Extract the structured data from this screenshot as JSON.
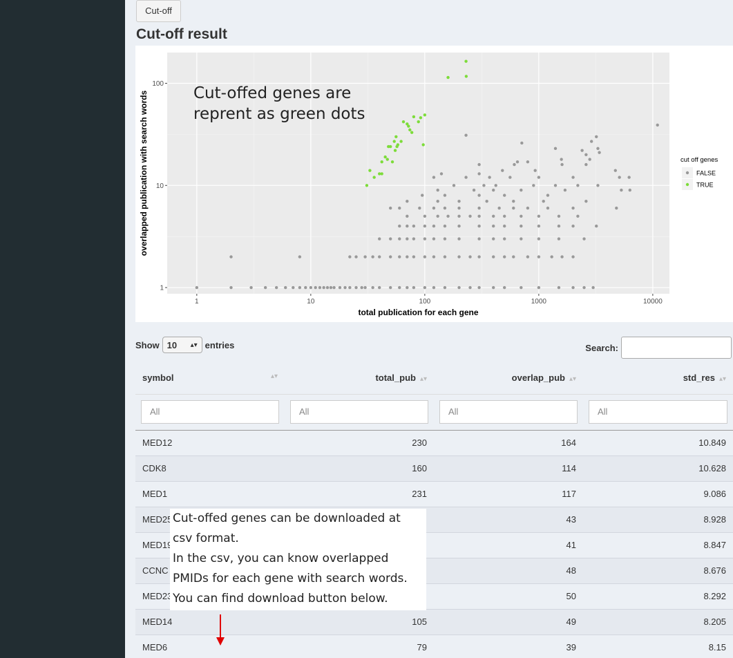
{
  "cutoff_button": "Cut-off",
  "section_title": "Cut-off result",
  "plot_note": [
    "Cut-offed genes are",
    "reprent as green dots"
  ],
  "chart_data": {
    "type": "scatter",
    "title": "",
    "xlabel": "total publication for each gene",
    "ylabel": "overlapped publication with search words",
    "x_scale": "log10",
    "y_scale": "log10",
    "xlim": [
      0.55,
      14000
    ],
    "ylim": [
      0.87,
      200
    ],
    "x_ticks": [
      1,
      10,
      100,
      1000,
      10000
    ],
    "x_tick_labels": [
      "1",
      "10",
      "100",
      "1000",
      "10000"
    ],
    "y_ticks": [
      1,
      10,
      100
    ],
    "y_tick_labels": [
      "1",
      "10",
      "100"
    ],
    "grid": true,
    "legend_title": "cut off genes",
    "legend_position": "right",
    "series": [
      {
        "name": "FALSE",
        "color": "#999999",
        "points": [
          [
            1,
            1
          ],
          [
            2,
            1
          ],
          [
            2,
            2
          ],
          [
            3,
            1
          ],
          [
            4,
            1
          ],
          [
            5,
            1
          ],
          [
            6,
            1
          ],
          [
            7,
            1
          ],
          [
            8,
            1
          ],
          [
            8,
            2
          ],
          [
            9,
            1
          ],
          [
            10,
            1
          ],
          [
            11,
            1
          ],
          [
            12,
            1
          ],
          [
            13,
            1
          ],
          [
            14,
            1
          ],
          [
            15,
            1
          ],
          [
            16,
            1
          ],
          [
            18,
            1
          ],
          [
            20,
            1
          ],
          [
            22,
            1
          ],
          [
            25,
            1
          ],
          [
            28,
            1
          ],
          [
            30,
            1
          ],
          [
            35,
            1
          ],
          [
            40,
            1
          ],
          [
            50,
            1
          ],
          [
            60,
            1
          ],
          [
            70,
            1
          ],
          [
            80,
            1
          ],
          [
            100,
            1
          ],
          [
            120,
            1
          ],
          [
            150,
            1
          ],
          [
            200,
            1
          ],
          [
            250,
            1
          ],
          [
            300,
            1
          ],
          [
            400,
            1
          ],
          [
            500,
            1
          ],
          [
            700,
            1
          ],
          [
            1000,
            1
          ],
          [
            1500,
            1
          ],
          [
            2000,
            1
          ],
          [
            2500,
            1
          ],
          [
            3000,
            1
          ],
          [
            22,
            2
          ],
          [
            25,
            2
          ],
          [
            30,
            2
          ],
          [
            35,
            2
          ],
          [
            40,
            2
          ],
          [
            50,
            2
          ],
          [
            60,
            2
          ],
          [
            70,
            2
          ],
          [
            80,
            2
          ],
          [
            100,
            2
          ],
          [
            120,
            2
          ],
          [
            150,
            2
          ],
          [
            200,
            2
          ],
          [
            250,
            2
          ],
          [
            300,
            2
          ],
          [
            400,
            2
          ],
          [
            500,
            2
          ],
          [
            600,
            2
          ],
          [
            800,
            2
          ],
          [
            1000,
            2
          ],
          [
            1300,
            2
          ],
          [
            1600,
            2
          ],
          [
            2000,
            2
          ],
          [
            40,
            3
          ],
          [
            50,
            3
          ],
          [
            60,
            3
          ],
          [
            70,
            3
          ],
          [
            80,
            3
          ],
          [
            100,
            3
          ],
          [
            120,
            3
          ],
          [
            150,
            3
          ],
          [
            200,
            3
          ],
          [
            300,
            3
          ],
          [
            400,
            3
          ],
          [
            500,
            3
          ],
          [
            700,
            3
          ],
          [
            1000,
            3
          ],
          [
            1500,
            3
          ],
          [
            2500,
            3
          ],
          [
            60,
            4
          ],
          [
            70,
            4
          ],
          [
            80,
            4
          ],
          [
            100,
            4
          ],
          [
            120,
            4
          ],
          [
            150,
            4
          ],
          [
            200,
            4
          ],
          [
            300,
            4
          ],
          [
            400,
            4
          ],
          [
            500,
            4
          ],
          [
            700,
            4
          ],
          [
            1000,
            4
          ],
          [
            1500,
            4
          ],
          [
            2000,
            4
          ],
          [
            3200,
            4
          ],
          [
            70,
            5
          ],
          [
            100,
            5
          ],
          [
            130,
            5
          ],
          [
            160,
            5
          ],
          [
            200,
            5
          ],
          [
            250,
            5
          ],
          [
            300,
            5
          ],
          [
            400,
            5
          ],
          [
            500,
            5
          ],
          [
            700,
            5
          ],
          [
            1000,
            5
          ],
          [
            1500,
            5
          ],
          [
            2200,
            5
          ],
          [
            50,
            6
          ],
          [
            60,
            6
          ],
          [
            90,
            6
          ],
          [
            120,
            6
          ],
          [
            150,
            6
          ],
          [
            200,
            6
          ],
          [
            300,
            6
          ],
          [
            450,
            6
          ],
          [
            600,
            6
          ],
          [
            800,
            6
          ],
          [
            1200,
            6
          ],
          [
            2000,
            6
          ],
          [
            4800,
            6
          ],
          [
            70,
            7
          ],
          [
            130,
            7
          ],
          [
            200,
            7
          ],
          [
            350,
            7
          ],
          [
            600,
            7
          ],
          [
            1100,
            7
          ],
          [
            2600,
            7
          ],
          [
            95,
            8
          ],
          [
            150,
            8
          ],
          [
            300,
            8
          ],
          [
            500,
            8
          ],
          [
            1200,
            8
          ],
          [
            130,
            9
          ],
          [
            270,
            9
          ],
          [
            400,
            9
          ],
          [
            700,
            9
          ],
          [
            1700,
            9
          ],
          [
            5300,
            9
          ],
          [
            6300,
            9
          ],
          [
            180,
            10
          ],
          [
            330,
            10
          ],
          [
            420,
            10
          ],
          [
            900,
            10
          ],
          [
            1400,
            10
          ],
          [
            2200,
            10
          ],
          [
            3300,
            10
          ],
          [
            120,
            12
          ],
          [
            230,
            12
          ],
          [
            370,
            12
          ],
          [
            560,
            12
          ],
          [
            1000,
            12
          ],
          [
            2000,
            12
          ],
          [
            5100,
            12
          ],
          [
            6200,
            12
          ],
          [
            140,
            13
          ],
          [
            300,
            13
          ],
          [
            480,
            14
          ],
          [
            930,
            14
          ],
          [
            4700,
            14
          ],
          [
            300,
            16
          ],
          [
            610,
            16
          ],
          [
            1600,
            16
          ],
          [
            2600,
            16
          ],
          [
            650,
            17
          ],
          [
            800,
            17
          ],
          [
            1580,
            18
          ],
          [
            2800,
            18
          ],
          [
            2600,
            20
          ],
          [
            3400,
            21
          ],
          [
            2400,
            22
          ],
          [
            3300,
            23
          ],
          [
            1400,
            23
          ],
          [
            710,
            26
          ],
          [
            2900,
            27
          ],
          [
            230,
            31
          ],
          [
            3200,
            30
          ],
          [
            11000,
            39
          ]
        ]
      },
      {
        "name": "TRUE",
        "color": "#7ddc3a",
        "points": [
          [
            230,
            164
          ],
          [
            160,
            114
          ],
          [
            231,
            117
          ],
          [
            31,
            10
          ],
          [
            33,
            14
          ],
          [
            36,
            12
          ],
          [
            40,
            13
          ],
          [
            42,
            13
          ],
          [
            42,
            17
          ],
          [
            45,
            19
          ],
          [
            47,
            18
          ],
          [
            48,
            24
          ],
          [
            50,
            24
          ],
          [
            52,
            17
          ],
          [
            54,
            27
          ],
          [
            55,
            22
          ],
          [
            56,
            30
          ],
          [
            57,
            24
          ],
          [
            58,
            25
          ],
          [
            62,
            27
          ],
          [
            65,
            42
          ],
          [
            70,
            40
          ],
          [
            72,
            38
          ],
          [
            74,
            35
          ],
          [
            77,
            33
          ],
          [
            80,
            47
          ],
          [
            88,
            42
          ],
          [
            92,
            46
          ],
          [
            100,
            49
          ],
          [
            97,
            25
          ]
        ]
      }
    ]
  },
  "table_controls": {
    "show_label": "Show",
    "length_value": "10",
    "entries_label": "entries",
    "search_label": "Search:"
  },
  "table": {
    "columns": [
      "symbol",
      "total_pub",
      "overlap_pub",
      "std_res"
    ],
    "filter_placeholder": "All",
    "rows": [
      [
        "MED12",
        "230",
        "164",
        "10.849"
      ],
      [
        "CDK8",
        "160",
        "114",
        "10.628"
      ],
      [
        "MED1",
        "231",
        "117",
        "9.086"
      ],
      [
        "MED25",
        "",
        "43",
        "8.928"
      ],
      [
        "MED19",
        "",
        "41",
        "8.847"
      ],
      [
        "CCNC",
        "",
        "48",
        "8.676"
      ],
      [
        "MED23",
        "",
        "50",
        "8.292"
      ],
      [
        "MED14",
        "105",
        "49",
        "8.205"
      ],
      [
        "MED6",
        "79",
        "39",
        "8.15"
      ]
    ]
  },
  "download_note": [
    "Cut-offed genes can be downloaded at",
    "csv format.",
    "In the csv, you can know overlapped",
    "PMIDs for each gene with   search words.",
    "You can find download button below."
  ],
  "colors": {
    "sidebar": "#222d32",
    "background": "#ecf0f5",
    "accent_arrow": "#e00000"
  }
}
